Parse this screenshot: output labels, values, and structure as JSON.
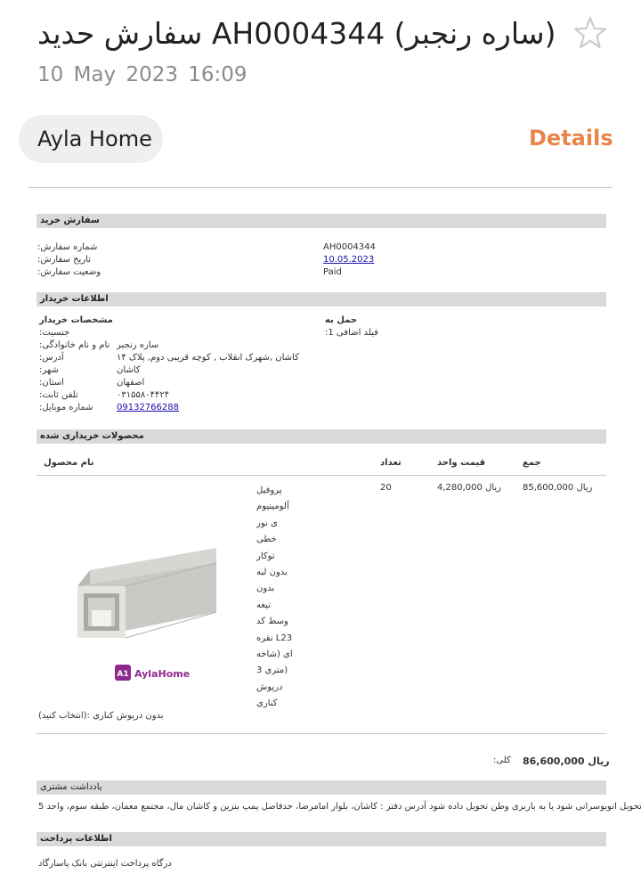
{
  "header": {
    "title": "سفارش حدید AH0004344 (ساره رنجبر)",
    "date": "10 May 2023  16:09",
    "sender": "Ayla Home",
    "details_label": "Details",
    "accent_color": "#e8854a",
    "star_icon": "star-outline-icon"
  },
  "order": {
    "section_title": "سفارش خرید",
    "number_label": ":شماره سفارش",
    "date_label": ":تاریخ سفارش",
    "status_label": ":وضعیت سفارش",
    "number": "AH0004344",
    "date": "10.05.2023",
    "status": "Paid"
  },
  "buyer": {
    "section_title": "اطلاعات خریدار",
    "details_title": "مشخصات خریدار",
    "shipping_title": "حمل به",
    "extra_field_label": ":فیلد اضافی 1",
    "labels": {
      "gender": ":جنسیت",
      "name": ":نام و نام خانوادگی",
      "address": ":آدرس",
      "city": ":شهر",
      "province": ":استان",
      "phone": ":تلفن ثابت",
      "mobile": ":شماره موبایل"
    },
    "values": {
      "name": "ساره رنجبر",
      "address": "کاشان ,شهرک انقلاب , کوچه قریبی دوم, پلاک ۱۴",
      "city": "کاشان",
      "province": "اصفهان",
      "phone": "۰۳۱۵۵۸۰۴۴۲۴",
      "mobile": "09132766288"
    }
  },
  "products": {
    "section_title": "محصولات خریداری شده",
    "columns": {
      "name": "نام محصول",
      "qty": "تعداد",
      "unit_price": "قیمت واحد",
      "total": "جمع"
    },
    "items": [
      {
        "name": "پروفیل\nآلومینیوم\nی نور\nخطی\nتوکار\nبدون لبه\nبدون\nتیغه\nوسط کد\nنقره L23\nای (شاخه\n3 متری)\nدرپوش\nکناری",
        "qty": "20",
        "unit_price": "4,280,000 ریال",
        "total": "85,600,000 ریال",
        "option": "(انتخاب کنید): بدون درپوش کناری",
        "brand": "AylaHome",
        "brand_mark": "A1",
        "brand_color": "#8e2a8e"
      }
    ],
    "total_label": ":کلی",
    "total_value": "86,600,000 ریال"
  },
  "note": {
    "section_title": "یادداشت مشتری",
    "text": "تحویل اتوبوسرانی شود یا به باربری وطن تحویل داده شود آدرس دفتر : کاشان، بلوار امامرضا، حدفاصل پمپ بنزین و کاشان مال، مجتمع معمان، طبقه سوم، واحد 5"
  },
  "payment": {
    "section_title": "اطلاعات پرداخت",
    "text": "درگاه پرداخت اینترنتی بانک پاسارگاد"
  }
}
